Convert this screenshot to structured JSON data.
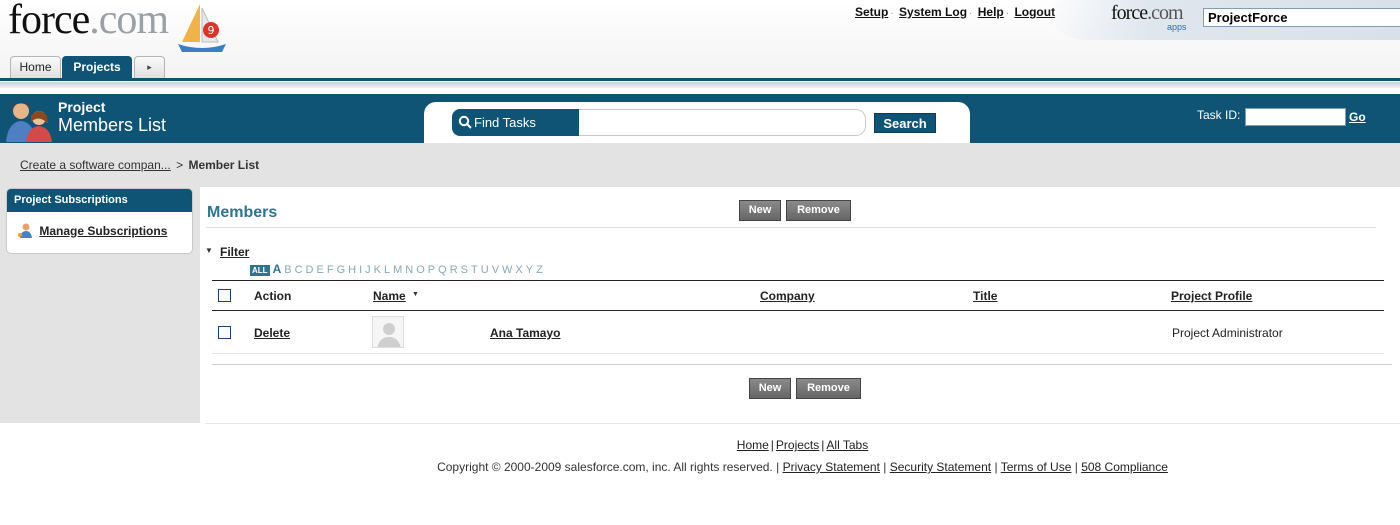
{
  "header": {
    "logo_text": "force",
    "logo_suffix": ".com",
    "logo_badge": "9",
    "links": [
      "Setup",
      "System Log",
      "Help",
      "Logout"
    ],
    "switcher_brand": "force",
    "switcher_suffix": ".com",
    "switcher_sub": "apps",
    "app_selected": "ProjectForce"
  },
  "tabs": [
    {
      "label": "Home",
      "active": false
    },
    {
      "label": "Projects",
      "active": true
    },
    {
      "label": "▸",
      "active": false
    }
  ],
  "banner": {
    "title_line1": "Project",
    "title_line2": "Members List",
    "search_label": "Find Tasks",
    "search_value": "",
    "search_button": "Search",
    "taskid_label": "Task ID:",
    "taskid_value": "",
    "go_label": "Go"
  },
  "breadcrumb": {
    "parent": "Create a software compan...",
    "separator": ">",
    "current": "Member List"
  },
  "sidebar": {
    "heading": "Project Subscriptions",
    "item": "Manage Subscriptions"
  },
  "members": {
    "title": "Members",
    "new_label": "New",
    "remove_label": "Remove",
    "filter_label": "Filter",
    "alpha_all": "ALL",
    "alpha_selected": "A",
    "alpha_letters": [
      "B",
      "C",
      "D",
      "E",
      "F",
      "G",
      "H",
      "I",
      "J",
      "K",
      "L",
      "M",
      "N",
      "O",
      "P",
      "Q",
      "R",
      "S",
      "T",
      "U",
      "V",
      "W",
      "X",
      "Y",
      "Z"
    ],
    "columns": {
      "action": "Action",
      "name": "Name",
      "company": "Company",
      "title": "Title",
      "profile": "Project Profile"
    },
    "rows": [
      {
        "action": "Delete",
        "name": "Ana Tamayo",
        "company": "",
        "title": "",
        "profile": "Project Administrator"
      }
    ]
  },
  "footer": {
    "links": [
      "Home",
      "Projects",
      "All Tabs"
    ],
    "copyright": "Copyright © 2000-2009 salesforce.com, inc. All rights reserved. |",
    "legal_links": [
      "Privacy Statement",
      "Security Statement",
      "Terms of Use",
      "508 Compliance"
    ]
  },
  "colors": {
    "brand_dark": "#0f5375",
    "accent_title": "#2f7391",
    "band_gray": "#e3e3e3",
    "button_gray": "#777777"
  }
}
